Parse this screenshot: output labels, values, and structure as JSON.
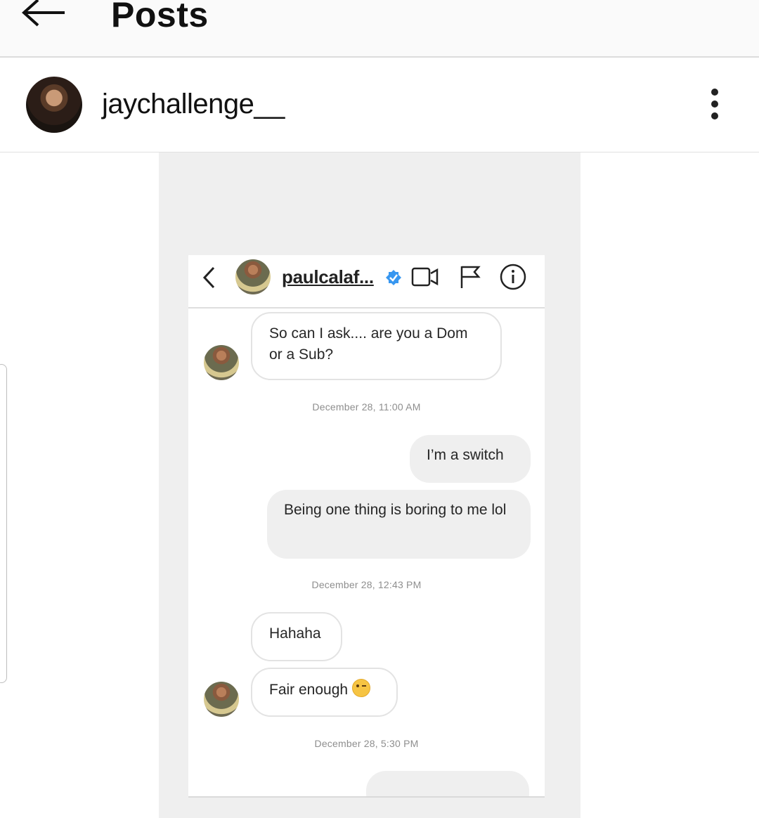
{
  "topbar": {
    "title": "Posts"
  },
  "profile": {
    "username": "jaychallenge__"
  },
  "dm": {
    "contact_name": "paulcalaf...",
    "messages": [
      {
        "side": "in",
        "text": "So can I ask.... are you a Dom or a Sub?"
      },
      {
        "side": "out",
        "text": "I’m a switch"
      },
      {
        "side": "out",
        "text": "Being one thing is boring to me lol"
      },
      {
        "side": "in",
        "text": "Hahaha"
      },
      {
        "side": "in",
        "text": "Fair enough"
      }
    ],
    "timestamps": [
      "December 28, 11:00 AM",
      "December 28, 12:43 PM",
      "December 28, 5:30 PM"
    ]
  },
  "icons": {
    "back": "arrow-left-icon",
    "more": "kebab-menu-icon",
    "dm_back": "chevron-left-icon",
    "verified": "verified-badge-icon",
    "video": "video-camera-icon",
    "flag": "flag-icon",
    "info": "info-icon",
    "emoji": "winking-face-emoji"
  },
  "colors": {
    "verified_blue": "#3897f0",
    "bubble_out": "#efefef",
    "timestamp": "#8e8e8e"
  }
}
